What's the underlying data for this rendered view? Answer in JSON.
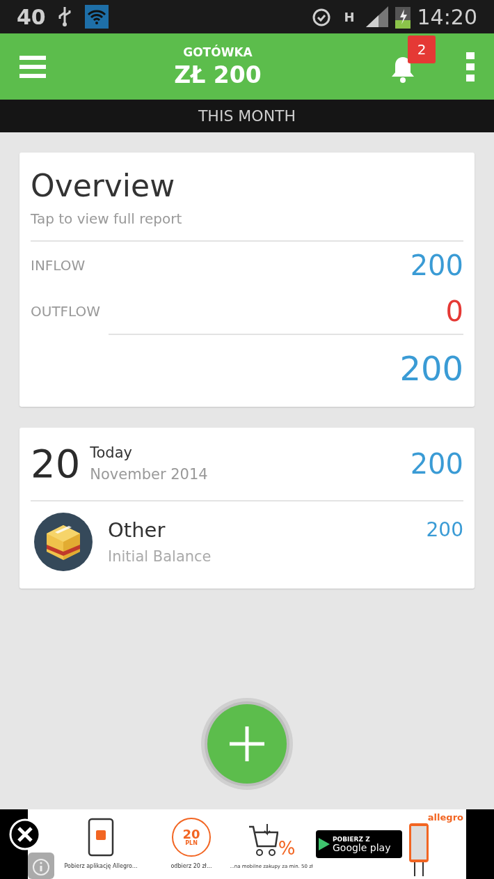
{
  "status_bar": {
    "left_text": "40",
    "network": "H",
    "time": "14:20"
  },
  "header": {
    "account": "GOTÓWKA",
    "balance": "ZŁ 200",
    "notification_count": "2"
  },
  "period": "THIS MONTH",
  "overview": {
    "title": "Overview",
    "subtitle": "Tap to view full report",
    "rows": [
      {
        "label": "INFLOW",
        "value": "200",
        "kind": "inflow"
      },
      {
        "label": "OUTFLOW",
        "value": "0",
        "kind": "outflow"
      }
    ],
    "total": "200"
  },
  "day_group": {
    "day": "20",
    "relative": "Today",
    "month": "November 2014",
    "total": "200",
    "transactions": [
      {
        "category": "Other",
        "note": "Initial Balance",
        "amount": "200"
      }
    ]
  },
  "ad": {
    "steps": [
      {
        "caption": "Pobierz aplikację  Allegro..."
      },
      {
        "caption": "odbierz 20 zł..."
      },
      {
        "caption": "...na mobilne zakupy za min. 50 zł"
      }
    ],
    "coupon_amount": "20",
    "coupon_unit": "PLN",
    "percent": "%",
    "store_small": "POBIERZ Z",
    "store_name": "Google play",
    "brand": "allegro"
  }
}
